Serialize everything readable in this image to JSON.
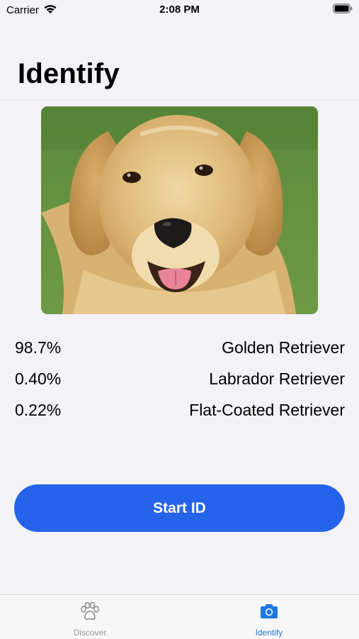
{
  "status_bar": {
    "carrier": "Carrier",
    "time": "2:08 PM"
  },
  "header": {
    "title": "Identify"
  },
  "photo": {
    "subject": "golden retriever dog photo"
  },
  "results": [
    {
      "confidence": "98.7%",
      "breed": "Golden Retriever"
    },
    {
      "confidence": "0.40%",
      "breed": "Labrador Retriever"
    },
    {
      "confidence": "0.22%",
      "breed": "Flat-Coated Retriever"
    }
  ],
  "actions": {
    "start_label": "Start ID"
  },
  "tab_bar": {
    "tabs": [
      {
        "label": "Discover",
        "icon": "paw-icon",
        "selected": false
      },
      {
        "label": "Identify",
        "icon": "camera-icon",
        "selected": true
      }
    ]
  },
  "colors": {
    "accent": "#2563eb",
    "tab_active": "#1f7ae0",
    "tab_inactive": "#999999"
  }
}
